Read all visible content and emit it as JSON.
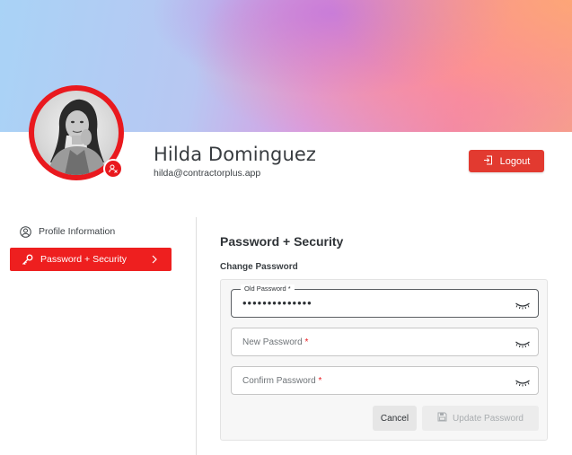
{
  "header": {
    "user_name": "Hilda Dominguez",
    "user_email": "hilda@contractorplus.app",
    "logout_label": "Logout"
  },
  "sidebar": {
    "items": [
      {
        "label": "Profile Information",
        "icon": "user-circle-icon",
        "active": false
      },
      {
        "label": "Password + Security",
        "icon": "key-icon",
        "active": true
      }
    ]
  },
  "main": {
    "title": "Password + Security",
    "subtitle": "Change Password",
    "fields": {
      "old_password": {
        "label": "Old Password",
        "required_mark": "*",
        "value": "••••••••••••••"
      },
      "new_password": {
        "placeholder": "New Password",
        "required_mark": "*",
        "value": ""
      },
      "confirm_password": {
        "placeholder": "Confirm Password",
        "required_mark": "*",
        "value": ""
      }
    },
    "cancel_label": "Cancel",
    "update_label": "Update Password"
  },
  "colors": {
    "accent": "#e9191e",
    "logout_bg": "#e23a30",
    "disabled_text": "#a9adb0"
  }
}
